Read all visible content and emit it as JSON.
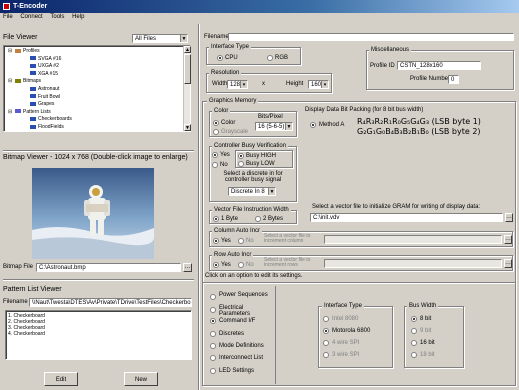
{
  "window": {
    "title": "T-Encoder",
    "accent": "#0a246a"
  },
  "menu": [
    "File",
    "Connect",
    "Tools",
    "Help"
  ],
  "file_viewer": {
    "title": "File Viewer",
    "filter": "All Files",
    "tree": [
      {
        "label": "Profiles",
        "icon": "folder-icon",
        "level": 0,
        "expander": "⊟"
      },
      {
        "label": "SVGA #16",
        "icon": "bitmap-icon",
        "level": 1
      },
      {
        "label": "UXGA #2",
        "icon": "bitmap-icon",
        "level": 1
      },
      {
        "label": "XGA #15",
        "icon": "bitmap-icon",
        "level": 1
      },
      {
        "label": "Bitmaps",
        "icon": "image-icon",
        "level": 0,
        "expander": "⊟"
      },
      {
        "label": "Astronaut",
        "icon": "bitmap-icon",
        "level": 1
      },
      {
        "label": "Fruit Bowl",
        "icon": "bitmap-icon",
        "level": 1
      },
      {
        "label": "Grapes",
        "icon": "bitmap-icon",
        "level": 1
      },
      {
        "label": "Pattern Lists",
        "icon": "pattern-icon",
        "level": 0,
        "expander": "⊟"
      },
      {
        "label": "Checkerboards",
        "icon": "bitmap-icon",
        "level": 1
      },
      {
        "label": "FloodFields",
        "icon": "bitmap-icon",
        "level": 1
      }
    ]
  },
  "bitmap_viewer": {
    "title": "Bitmap Viewer - 1024 x 768 (Double-click image to enlarge)",
    "file_label": "Bitmap File",
    "file_value": "C:\\Astronaut.bmp"
  },
  "pattern_viewer": {
    "title": "Pattern List Viewer",
    "file_label": "Filename",
    "file_value": "\\\\Naut\\Twesta\\DTES\\Av\\Private\\TDrive\\TestFiles\\Checkerbo",
    "items": [
      "1. Checkerboard",
      "2. Checkerboard",
      "3. Checkerboard",
      "4. Checkerboard"
    ],
    "edit_label": "Edit",
    "new_label": "New"
  },
  "filename": {
    "label": "Filename",
    "value": ""
  },
  "interface_type": {
    "title": "Interface Type",
    "options": [
      "CPU",
      "RGB"
    ],
    "selected": "CPU"
  },
  "resolution": {
    "title": "Resolution",
    "width_label": "Width",
    "width": "128",
    "x": "x",
    "height_label": "Height",
    "height": "160"
  },
  "graphics_memory": {
    "title": "Graphics Memory",
    "color_title": "Color",
    "bits_label": "Bits/Pixel",
    "color_option": "Color",
    "grayscale_option": "Grayscale",
    "bits_value": "16 (5-6-5)"
  },
  "controller_busy": {
    "title": "Controller Busy Verification",
    "yes": "Yes",
    "no": "No",
    "busy_high": "Busy HIGH",
    "busy_low": "Busy LOW",
    "discrete_help": "Select a discrete in for controller busy signal",
    "discrete_value": "Discrete In 8"
  },
  "vector_width": {
    "title": "Vector File Instruction Width",
    "one": "1 Byte",
    "two": "2 Bytes"
  },
  "column_auto": {
    "title": "Column Auto Incr",
    "yes": "Yes",
    "no": "No",
    "help": "Select a vector file to increment column"
  },
  "row_auto": {
    "title": "Row Auto Incr",
    "yes": "Yes",
    "no": "No",
    "help": "Select a vector file to increment rows"
  },
  "misc": {
    "title": "Miscellaneous",
    "profile_id_label": "Profile ID",
    "profile_id": "CSTN_128x160",
    "profile_number_label": "Profile Number",
    "profile_number": "0"
  },
  "packing": {
    "title": "Display Data Bit Packing (for 8 bit bus width)",
    "method": "Method A",
    "line1": "R₄R₃R₂R₁R₀G₅G₄G₃ (LSB byte 1)",
    "line2": "G₂G₁G₀B₄B₃B₂B₁B₀ (LSB byte 2)"
  },
  "vector_init": {
    "help": "Select a vector file to initialize GRAM for writing of display data:",
    "value": "C:\\init.vdv"
  },
  "settings": {
    "help": "Click on an option to edit its settings.",
    "options": [
      "Power Sequences",
      "Electrical Parameters",
      "Command I/F",
      "Discretes",
      "Mode Definitions",
      "Interconnect List",
      "LED Settings"
    ],
    "selected": "Command I/F"
  },
  "cmd_interface": {
    "title": "Interface Type",
    "options": [
      "Intel 8080",
      "Motorola 6800",
      "4 wire SPI",
      "3 wire SPI"
    ],
    "selected": "Motorola 6800"
  },
  "bus_width": {
    "title": "Bus Width",
    "options": [
      "8 bit",
      "9 bit",
      "16 bit",
      "18 bit"
    ],
    "selected": "8 bit"
  }
}
